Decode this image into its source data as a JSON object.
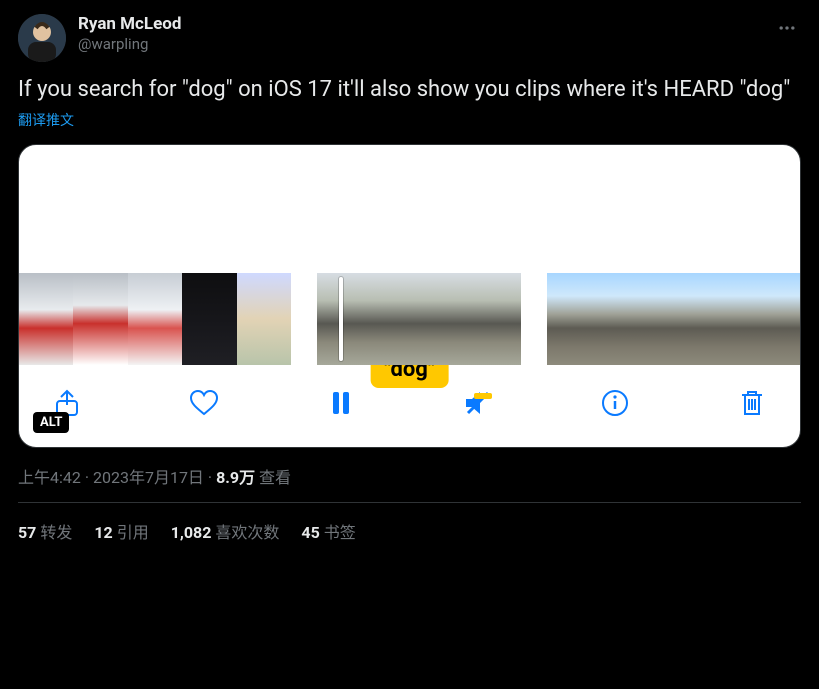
{
  "author": {
    "display_name": "Ryan McLeod",
    "handle": "@warpling"
  },
  "body": "If you search for \"dog\" on iOS 17 it'll also show you clips where it's HEARD \"dog\"",
  "translate_label": "翻译推文",
  "media": {
    "tooltip": "\"dog\"",
    "alt_badge": "ALT"
  },
  "meta": {
    "time": "上午4:42",
    "dot1": " · ",
    "date": "2023年7月17日",
    "dot2": " · ",
    "views_num": "8.9万",
    "views_label": " 查看"
  },
  "stats": {
    "retweets_num": "57",
    "retweets_label": "转发",
    "quotes_num": "12",
    "quotes_label": "引用",
    "likes_num": "1,082",
    "likes_label": "喜欢次数",
    "bookmarks_num": "45",
    "bookmarks_label": "书签"
  }
}
